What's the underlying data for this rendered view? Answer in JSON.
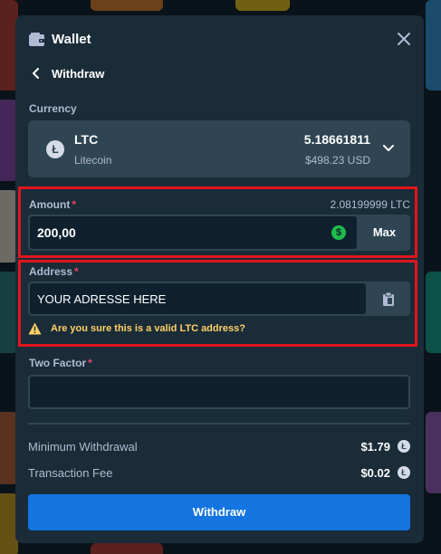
{
  "header": {
    "title": "Wallet"
  },
  "nav": {
    "back_label": "Withdraw"
  },
  "currency": {
    "label": "Currency",
    "code": "LTC",
    "name": "Litecoin",
    "balance": "5.18661811",
    "balance_usd": "$498.23 USD",
    "coin_glyph": "Ł"
  },
  "amount": {
    "label": "Amount",
    "required_mark": "*",
    "available": "2.08199999 LTC",
    "value": "200,00",
    "currency_glyph": "$",
    "max_label": "Max"
  },
  "address": {
    "label": "Address",
    "required_mark": "*",
    "value": "YOUR ADRESSE HERE",
    "warning": "Are you sure this is a valid LTC address?"
  },
  "two_factor": {
    "label": "Two Factor",
    "required_mark": "*",
    "value": ""
  },
  "fees": [
    {
      "label": "Minimum Withdrawal",
      "value": "$1.79",
      "coin_glyph": "Ł"
    },
    {
      "label": "Transaction Fee",
      "value": "$0.02",
      "coin_glyph": "Ł"
    }
  ],
  "submit": {
    "label": "Withdraw"
  },
  "colors": {
    "modal_bg": "#1a2c38",
    "input_bg": "#0f212e",
    "surface": "#2f4553",
    "primary_button": "#1475e1",
    "highlight_border": "#e0161c",
    "required": "#ed4163",
    "warning": "#ffd166",
    "success": "#1fbd4a"
  },
  "icons": {
    "wallet": "wallet-icon",
    "close": "close-icon",
    "back": "chevron-left-icon",
    "dropdown": "chevron-down-icon",
    "paste": "clipboard-icon",
    "warning": "warning-icon"
  }
}
